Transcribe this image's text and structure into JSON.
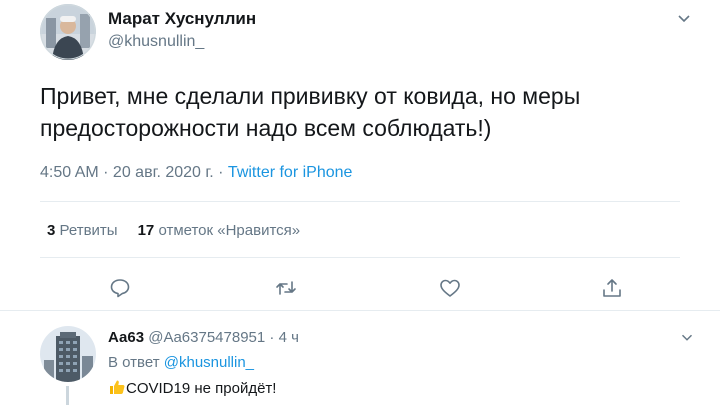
{
  "tweet": {
    "author_name": "Марат Хуснуллин",
    "author_handle": "@khusnullin_",
    "avatar_icon": "avatar-photo-icon",
    "text": "Привет, мне сделали прививку от ковида, но меры предосторожности надо всем соблюдать!)",
    "time": "4:50 AM",
    "separator1": " · ",
    "date": "20 авг. 2020 г.",
    "separator2": " · ",
    "source": "Twitter for iPhone",
    "retweet_count": "3",
    "retweet_label": "Ретвиты",
    "like_count": "17",
    "like_label": "отметок «Нравится»",
    "actions": [
      "reply-icon",
      "retweet-icon",
      "like-icon",
      "share-icon"
    ]
  },
  "reply": {
    "author_name": "Аа63",
    "author_handle": "@Aa6375478951",
    "dot": " · ",
    "time": "4 ч",
    "reply_to_prefix": "В ответ ",
    "reply_to_handle": "@khusnullin_",
    "emoji": "thumbs-up-icon",
    "text": "COVID19 не пройдёт!"
  },
  "colors": {
    "text": "#14171a",
    "secondary": "#657786",
    "link": "#1b95e0",
    "divider": "#e6ecf0"
  }
}
